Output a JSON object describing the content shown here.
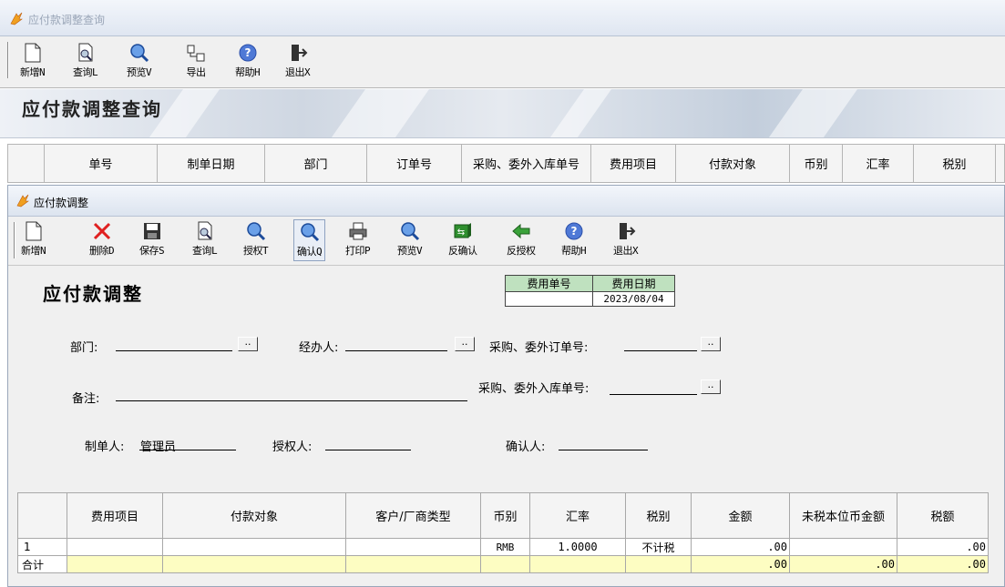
{
  "outer": {
    "title": "应付款调整查询",
    "toolbar": [
      {
        "label": "新增N",
        "icon": "new-document-icon"
      },
      {
        "label": "查询L",
        "icon": "query-document-icon"
      },
      {
        "label": "预览V",
        "icon": "magnifier-icon"
      },
      {
        "label": "导出",
        "icon": "export-icon"
      },
      {
        "label": "帮助H",
        "icon": "help-icon"
      },
      {
        "label": "退出X",
        "icon": "exit-door-icon"
      }
    ],
    "banner_title": "应付款调整查询",
    "list_columns": [
      "单号",
      "制单日期",
      "部门",
      "订单号",
      "采购、委外入库单号",
      "费用项目",
      "付款对象",
      "币别",
      "汇率",
      "税别"
    ]
  },
  "inner": {
    "title": "应付款调整",
    "toolbar": [
      {
        "label": "新增N",
        "icon": "new-document-icon"
      },
      {
        "label": "删除D",
        "icon": "delete-x-icon"
      },
      {
        "label": "保存S",
        "icon": "save-disk-icon"
      },
      {
        "label": "查询L",
        "icon": "query-document-icon"
      },
      {
        "label": "授权T",
        "icon": "magnifier-icon"
      },
      {
        "label": "确认Q",
        "icon": "magnifier-icon"
      },
      {
        "label": "打印P",
        "icon": "printer-icon"
      },
      {
        "label": "预览V",
        "icon": "magnifier-icon"
      },
      {
        "label": "反确认",
        "icon": "unconfirm-icon"
      },
      {
        "label": "反授权",
        "icon": "unauthorize-icon"
      },
      {
        "label": "帮助H",
        "icon": "help-icon"
      },
      {
        "label": "退出X",
        "icon": "exit-door-icon"
      }
    ],
    "form_title": "应付款调整",
    "fee_box": {
      "no_label": "费用单号",
      "date_label": "费用日期",
      "no_value": "",
      "date_value": "2023/08/04"
    },
    "fields": {
      "dept_label": "部门:",
      "handler_label": "经办人:",
      "order_no_label": "采购、委外订单号:",
      "remark_label": "备注:",
      "inbound_no_label": "采购、委外入库单号:",
      "creator_label": "制单人:",
      "creator_value": "管理员",
      "authorizer_label": "授权人:",
      "confirmer_label": "确认人:",
      "browse_label": ".."
    },
    "grid": {
      "columns": [
        "",
        "费用项目",
        "付款对象",
        "客户/厂商类型",
        "币别",
        "汇率",
        "税别",
        "金额",
        "未税本位币金额",
        "税额"
      ],
      "row": {
        "no": "1",
        "item": "",
        "payee": "",
        "type": "",
        "currency": "RMB",
        "rate": "1.0000",
        "tax_type": "不计税",
        "amount": ".00",
        "untaxed": "",
        "tax": ".00"
      },
      "total": {
        "label": "合计",
        "amount": ".00",
        "untaxed": ".00",
        "tax": ".00"
      }
    }
  }
}
